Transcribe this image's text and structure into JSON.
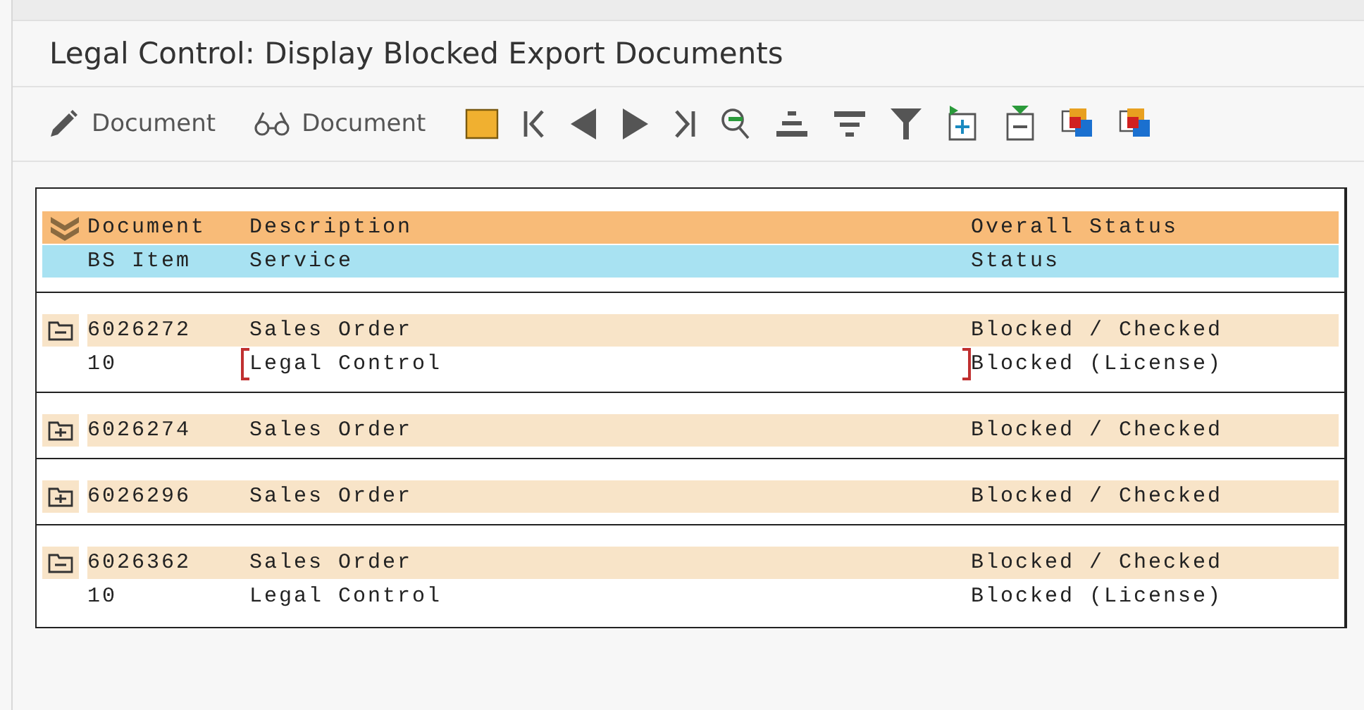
{
  "window": {
    "title": "Legal Control: Display Blocked Export Documents"
  },
  "toolbar": [
    {
      "kind": "text",
      "label": "Document"
    },
    {
      "kind": "text",
      "label": "Document"
    },
    {
      "kind": "icon"
    },
    {
      "kind": "icon"
    },
    {
      "kind": "icon"
    },
    {
      "kind": "icon"
    },
    {
      "kind": "icon"
    },
    {
      "kind": "icon"
    },
    {
      "kind": "icon"
    },
    {
      "kind": "icon"
    },
    {
      "kind": "icon"
    },
    {
      "kind": "icon"
    },
    {
      "kind": "icon"
    },
    {
      "kind": "icon"
    },
    {
      "kind": "icon"
    }
  ],
  "list": {
    "header": [
      [
        "Document",
        "Description",
        "Overall Status"
      ],
      [
        "BS Item",
        "Service",
        "Status"
      ]
    ],
    "groups": [
      {
        "expanded": true,
        "document": "6026272",
        "description": "Sales Order",
        "status": "Blocked / Checked",
        "items": [
          {
            "item": "10",
            "service": "Legal Control",
            "status": "Blocked (License)",
            "focused": true
          }
        ]
      },
      {
        "expanded": false,
        "document": "6026274",
        "description": "Sales Order",
        "status": "Blocked / Checked"
      },
      {
        "expanded": false,
        "document": "6026296",
        "description": "Sales Order",
        "status": "Blocked / Checked"
      },
      {
        "expanded": true,
        "document": "6026362",
        "description": "Sales Order",
        "status": "Blocked / Checked",
        "items": [
          {
            "item": "10",
            "service": "Legal Control",
            "status": "Blocked (License)",
            "focused": false
          }
        ]
      }
    ]
  }
}
